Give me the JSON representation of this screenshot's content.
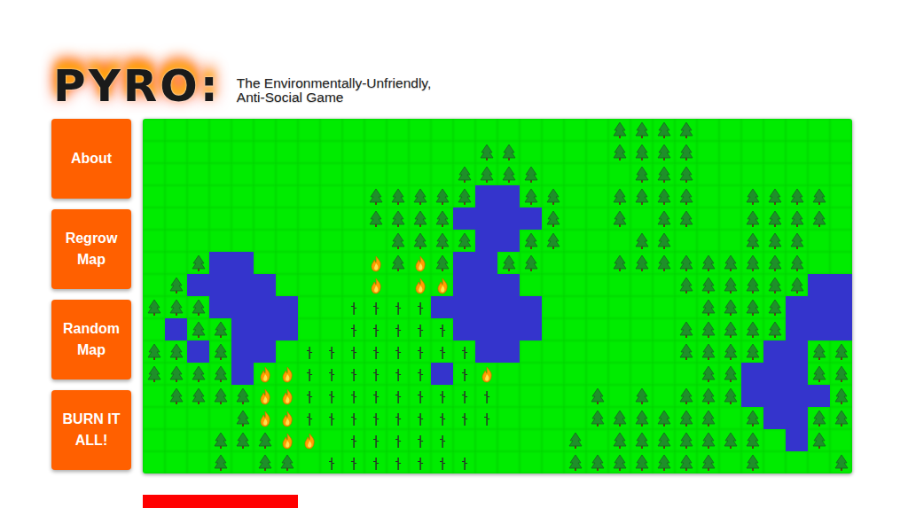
{
  "header": {
    "logo": "PYRO:",
    "tagline": [
      "The Environmentally-Unfriendly,",
      "Anti-Social Game"
    ]
  },
  "buttons": [
    {
      "label": "About"
    },
    {
      "label": "Regrow Map"
    },
    {
      "label": "Random Map"
    },
    {
      "label": "BURN IT ALL!"
    }
  ],
  "board": {
    "rows": [
      ".....................TTTT.......",
      "...............TT....TTTT.......",
      "..............TTTT....TTT.......",
      "..........TTTTTWWTT..TTTT..TTTT.",
      "..........TTTTWWWWT..T.TT..TTTT.",
      "...........TTTTWWTT...TT...TTT..",
      "..TWW.....FTFTWWTT...TTTTTTTTT..",
      ".TWWWW....F.FFWWW.......TTTTTTWW",
      "TTTWWWW..BBBBWWWWW.......TTTTWWW",
      ".WTTWWW..BBBBBWWWW......TTTTTWWW",
      "TTWTWW.BBBBBBBBWW.......TTTTWWTT",
      "TTTTWFFBBBBBBWBF.........TTWWWTT",
      ".TTTTFFBBBBBBBBB....T.T.TTTWWWWT",
      "....TFFBBBBBBBBB....TTTTTT.TWWTT",
      "...TTTFF.BBBBB.....T.TTTTTTT.WT.",
      "...T.TT.BBBBBBB....TTTTTTT.T...T"
    ]
  },
  "burn_meter": {
    "level": 0.21875
  }
}
